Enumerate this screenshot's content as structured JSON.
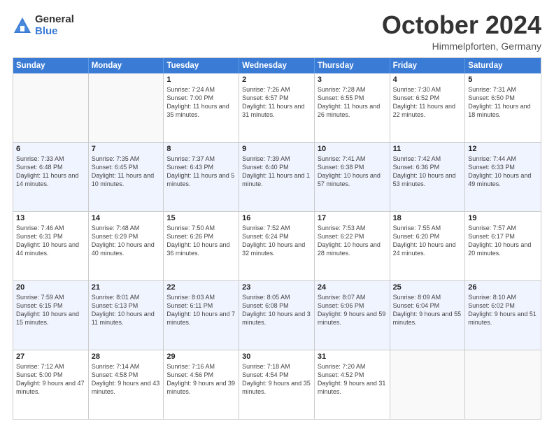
{
  "logo": {
    "general": "General",
    "blue": "Blue"
  },
  "title": "October 2024",
  "location": "Himmelpforten, Germany",
  "header_days": [
    "Sunday",
    "Monday",
    "Tuesday",
    "Wednesday",
    "Thursday",
    "Friday",
    "Saturday"
  ],
  "rows": [
    {
      "alt": false,
      "cells": [
        {
          "day": "",
          "sunrise": "",
          "sunset": "",
          "daylight": ""
        },
        {
          "day": "",
          "sunrise": "",
          "sunset": "",
          "daylight": ""
        },
        {
          "day": "1",
          "sunrise": "Sunrise: 7:24 AM",
          "sunset": "Sunset: 7:00 PM",
          "daylight": "Daylight: 11 hours and 35 minutes."
        },
        {
          "day": "2",
          "sunrise": "Sunrise: 7:26 AM",
          "sunset": "Sunset: 6:57 PM",
          "daylight": "Daylight: 11 hours and 31 minutes."
        },
        {
          "day": "3",
          "sunrise": "Sunrise: 7:28 AM",
          "sunset": "Sunset: 6:55 PM",
          "daylight": "Daylight: 11 hours and 26 minutes."
        },
        {
          "day": "4",
          "sunrise": "Sunrise: 7:30 AM",
          "sunset": "Sunset: 6:52 PM",
          "daylight": "Daylight: 11 hours and 22 minutes."
        },
        {
          "day": "5",
          "sunrise": "Sunrise: 7:31 AM",
          "sunset": "Sunset: 6:50 PM",
          "daylight": "Daylight: 11 hours and 18 minutes."
        }
      ]
    },
    {
      "alt": true,
      "cells": [
        {
          "day": "6",
          "sunrise": "Sunrise: 7:33 AM",
          "sunset": "Sunset: 6:48 PM",
          "daylight": "Daylight: 11 hours and 14 minutes."
        },
        {
          "day": "7",
          "sunrise": "Sunrise: 7:35 AM",
          "sunset": "Sunset: 6:45 PM",
          "daylight": "Daylight: 11 hours and 10 minutes."
        },
        {
          "day": "8",
          "sunrise": "Sunrise: 7:37 AM",
          "sunset": "Sunset: 6:43 PM",
          "daylight": "Daylight: 11 hours and 5 minutes."
        },
        {
          "day": "9",
          "sunrise": "Sunrise: 7:39 AM",
          "sunset": "Sunset: 6:40 PM",
          "daylight": "Daylight: 11 hours and 1 minute."
        },
        {
          "day": "10",
          "sunrise": "Sunrise: 7:41 AM",
          "sunset": "Sunset: 6:38 PM",
          "daylight": "Daylight: 10 hours and 57 minutes."
        },
        {
          "day": "11",
          "sunrise": "Sunrise: 7:42 AM",
          "sunset": "Sunset: 6:36 PM",
          "daylight": "Daylight: 10 hours and 53 minutes."
        },
        {
          "day": "12",
          "sunrise": "Sunrise: 7:44 AM",
          "sunset": "Sunset: 6:33 PM",
          "daylight": "Daylight: 10 hours and 49 minutes."
        }
      ]
    },
    {
      "alt": false,
      "cells": [
        {
          "day": "13",
          "sunrise": "Sunrise: 7:46 AM",
          "sunset": "Sunset: 6:31 PM",
          "daylight": "Daylight: 10 hours and 44 minutes."
        },
        {
          "day": "14",
          "sunrise": "Sunrise: 7:48 AM",
          "sunset": "Sunset: 6:29 PM",
          "daylight": "Daylight: 10 hours and 40 minutes."
        },
        {
          "day": "15",
          "sunrise": "Sunrise: 7:50 AM",
          "sunset": "Sunset: 6:26 PM",
          "daylight": "Daylight: 10 hours and 36 minutes."
        },
        {
          "day": "16",
          "sunrise": "Sunrise: 7:52 AM",
          "sunset": "Sunset: 6:24 PM",
          "daylight": "Daylight: 10 hours and 32 minutes."
        },
        {
          "day": "17",
          "sunrise": "Sunrise: 7:53 AM",
          "sunset": "Sunset: 6:22 PM",
          "daylight": "Daylight: 10 hours and 28 minutes."
        },
        {
          "day": "18",
          "sunrise": "Sunrise: 7:55 AM",
          "sunset": "Sunset: 6:20 PM",
          "daylight": "Daylight: 10 hours and 24 minutes."
        },
        {
          "day": "19",
          "sunrise": "Sunrise: 7:57 AM",
          "sunset": "Sunset: 6:17 PM",
          "daylight": "Daylight: 10 hours and 20 minutes."
        }
      ]
    },
    {
      "alt": true,
      "cells": [
        {
          "day": "20",
          "sunrise": "Sunrise: 7:59 AM",
          "sunset": "Sunset: 6:15 PM",
          "daylight": "Daylight: 10 hours and 15 minutes."
        },
        {
          "day": "21",
          "sunrise": "Sunrise: 8:01 AM",
          "sunset": "Sunset: 6:13 PM",
          "daylight": "Daylight: 10 hours and 11 minutes."
        },
        {
          "day": "22",
          "sunrise": "Sunrise: 8:03 AM",
          "sunset": "Sunset: 6:11 PM",
          "daylight": "Daylight: 10 hours and 7 minutes."
        },
        {
          "day": "23",
          "sunrise": "Sunrise: 8:05 AM",
          "sunset": "Sunset: 6:08 PM",
          "daylight": "Daylight: 10 hours and 3 minutes."
        },
        {
          "day": "24",
          "sunrise": "Sunrise: 8:07 AM",
          "sunset": "Sunset: 6:06 PM",
          "daylight": "Daylight: 9 hours and 59 minutes."
        },
        {
          "day": "25",
          "sunrise": "Sunrise: 8:09 AM",
          "sunset": "Sunset: 6:04 PM",
          "daylight": "Daylight: 9 hours and 55 minutes."
        },
        {
          "day": "26",
          "sunrise": "Sunrise: 8:10 AM",
          "sunset": "Sunset: 6:02 PM",
          "daylight": "Daylight: 9 hours and 51 minutes."
        }
      ]
    },
    {
      "alt": false,
      "cells": [
        {
          "day": "27",
          "sunrise": "Sunrise: 7:12 AM",
          "sunset": "Sunset: 5:00 PM",
          "daylight": "Daylight: 9 hours and 47 minutes."
        },
        {
          "day": "28",
          "sunrise": "Sunrise: 7:14 AM",
          "sunset": "Sunset: 4:58 PM",
          "daylight": "Daylight: 9 hours and 43 minutes."
        },
        {
          "day": "29",
          "sunrise": "Sunrise: 7:16 AM",
          "sunset": "Sunset: 4:56 PM",
          "daylight": "Daylight: 9 hours and 39 minutes."
        },
        {
          "day": "30",
          "sunrise": "Sunrise: 7:18 AM",
          "sunset": "Sunset: 4:54 PM",
          "daylight": "Daylight: 9 hours and 35 minutes."
        },
        {
          "day": "31",
          "sunrise": "Sunrise: 7:20 AM",
          "sunset": "Sunset: 4:52 PM",
          "daylight": "Daylight: 9 hours and 31 minutes."
        },
        {
          "day": "",
          "sunrise": "",
          "sunset": "",
          "daylight": ""
        },
        {
          "day": "",
          "sunrise": "",
          "sunset": "",
          "daylight": ""
        }
      ]
    }
  ]
}
